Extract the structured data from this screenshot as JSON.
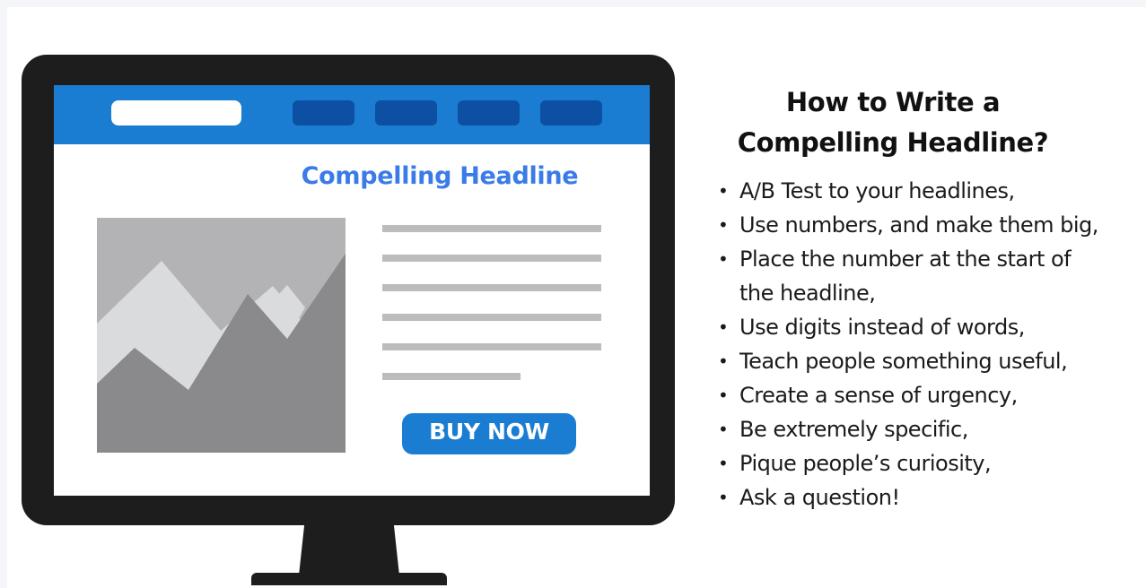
{
  "screen": {
    "headline": "Compelling Headline",
    "buy_button": "BUY NOW"
  },
  "icons": {
    "image_placeholder": "mountain-image-icon"
  },
  "colors": {
    "nav_blue": "#1b7dd2",
    "nav_button_dark_blue": "#0d4fa3",
    "headline_blue": "#3a7be8",
    "monitor_black": "#1d1d1d"
  },
  "panel": {
    "title_line1": "How to Write a",
    "title_line2": "Compelling Headline?",
    "tips": [
      "A/B Test to your headlines,",
      "Use numbers, and make them big,",
      "Place the number at the start of the headline,",
      "Use digits instead of words,",
      "Teach people something useful,",
      "Create a sense of urgency,",
      "Be extremely specific,",
      "Pique people’s curiosity,",
      "Ask a question!"
    ]
  }
}
